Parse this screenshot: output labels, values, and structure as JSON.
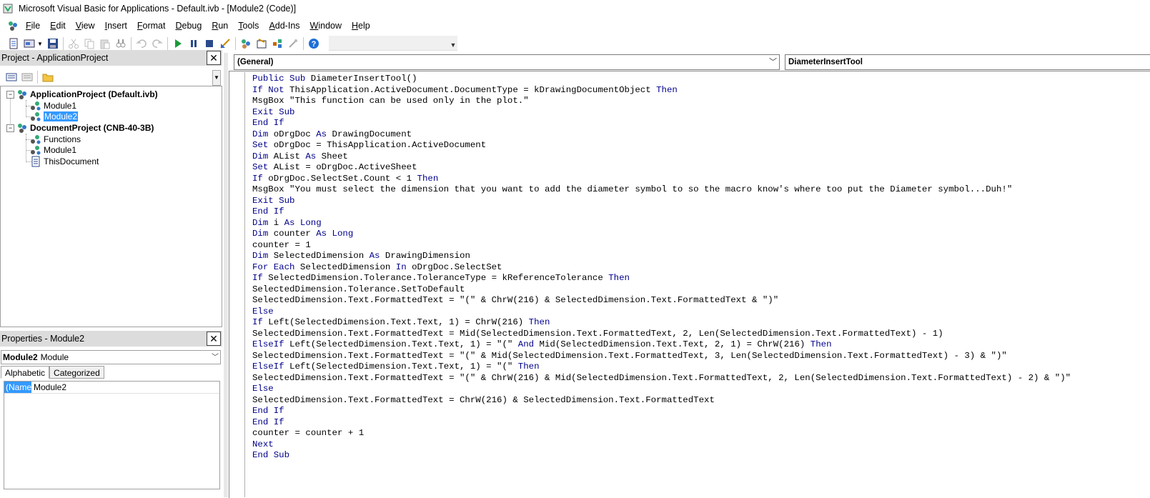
{
  "window": {
    "title": "Microsoft Visual Basic for Applications - Default.ivb - [Module2 (Code)]"
  },
  "menu": [
    {
      "label": "File",
      "u": "F",
      "rest": "ile"
    },
    {
      "label": "Edit",
      "u": "E",
      "rest": "dit"
    },
    {
      "label": "View",
      "u": "V",
      "rest": "iew"
    },
    {
      "label": "Insert",
      "u": "I",
      "rest": "nsert"
    },
    {
      "label": "Format",
      "u": "F",
      "rest": "ormat"
    },
    {
      "label": "Debug",
      "u": "D",
      "rest": "ebug"
    },
    {
      "label": "Run",
      "u": "R",
      "rest": "un"
    },
    {
      "label": "Tools",
      "u": "T",
      "rest": "ools"
    },
    {
      "label": "Add-Ins",
      "u": "A",
      "rest": "dd-Ins"
    },
    {
      "label": "Window",
      "u": "W",
      "rest": "indow"
    },
    {
      "label": "Help",
      "u": "H",
      "rest": "elp"
    }
  ],
  "project_pane": {
    "title": "Project - ApplicationProject",
    "tree": {
      "app_project": "ApplicationProject (Default.ivb)",
      "app_module1": "Module1",
      "app_module2": "Module2",
      "doc_project": "DocumentProject (CNB-40-3B)",
      "doc_functions": "Functions",
      "doc_module1": "Module1",
      "doc_thisdocument": "ThisDocument"
    }
  },
  "properties_pane": {
    "title": "Properties - Module2",
    "object_name": "Module2",
    "object_type": "Module",
    "tab_alphabetic": "Alphabetic",
    "tab_categorized": "Categorized",
    "prop_name": "(Name)",
    "prop_value": "Module2"
  },
  "code_window": {
    "object_combo": "(General)",
    "proc_combo": "DiameterInsertTool",
    "lines": [
      "<span class=\"kw\">Public Sub</span> DiameterInsertTool()",
      "<span class=\"kw\">If Not</span> ThisApplication.ActiveDocument.DocumentType = kDrawingDocumentObject <span class=\"kw\">Then</span>",
      "MsgBox \"This function can be used only in the plot.\"",
      "<span class=\"kw\">Exit Sub</span>",
      "<span class=\"kw\">End If</span>",
      "<span class=\"kw\">Dim</span> oDrgDoc <span class=\"kw\">As</span> DrawingDocument",
      "<span class=\"kw\">Set</span> oDrgDoc = ThisApplication.ActiveDocument",
      "<span class=\"kw\">Dim</span> AList <span class=\"kw\">As</span> Sheet",
      "<span class=\"kw\">Set</span> AList = oDrgDoc.ActiveSheet",
      "<span class=\"kw\">If</span> oDrgDoc.SelectSet.Count &lt; 1 <span class=\"kw\">Then</span>",
      "MsgBox \"You must select the dimension that you want to add the diameter symbol to so the macro know's where too put the Diameter symbol...Duh!\"",
      "<span class=\"kw\">Exit Sub</span>",
      "<span class=\"kw\">End If</span>",
      "<span class=\"kw\">Dim</span> i <span class=\"kw\">As Long</span>",
      "<span class=\"kw\">Dim</span> counter <span class=\"kw\">As Long</span>",
      "counter = 1",
      "<span class=\"kw\">Dim</span> SelectedDimension <span class=\"kw\">As</span> DrawingDimension",
      "<span class=\"kw\">For Each</span> SelectedDimension <span class=\"kw\">In</span> oDrgDoc.SelectSet",
      "<span class=\"kw\">If</span> SelectedDimension.Tolerance.ToleranceType = kReferenceTolerance <span class=\"kw\">Then</span>",
      "SelectedDimension.Tolerance.SetToDefault",
      "SelectedDimension.Text.FormattedText = \"(\" &amp; ChrW(216) &amp; SelectedDimension.Text.FormattedText &amp; \")\"",
      "<span class=\"kw\">Else</span>",
      "<span class=\"kw\">If</span> Left(SelectedDimension.Text.Text, 1) = ChrW(216) <span class=\"kw\">Then</span>",
      "SelectedDimension.Text.FormattedText = Mid(SelectedDimension.Text.FormattedText, 2, Len(SelectedDimension.Text.FormattedText) - 1)",
      "<span class=\"kw\">ElseIf</span> Left(SelectedDimension.Text.Text, 1) = \"(\" <span class=\"kw\">And</span> Mid(SelectedDimension.Text.Text, 2, 1) = ChrW(216) <span class=\"kw\">Then</span>",
      "SelectedDimension.Text.FormattedText = \"(\" &amp; Mid(SelectedDimension.Text.FormattedText, 3, Len(SelectedDimension.Text.FormattedText) - 3) &amp; \")\"",
      "<span class=\"kw\">ElseIf</span> Left(SelectedDimension.Text.Text, 1) = \"(\" <span class=\"kw\">Then</span>",
      "SelectedDimension.Text.FormattedText = \"(\" &amp; ChrW(216) &amp; Mid(SelectedDimension.Text.FormattedText, 2, Len(SelectedDimension.Text.FormattedText) - 2) &amp; \")\"",
      "<span class=\"kw\">Else</span>",
      "SelectedDimension.Text.FormattedText = ChrW(216) &amp; SelectedDimension.Text.FormattedText",
      "<span class=\"kw\">End If</span>",
      "<span class=\"kw\">End If</span>",
      "counter = counter + 1",
      "<span class=\"kw\">Next</span>",
      "<span class=\"kw\">End Sub</span>"
    ]
  },
  "colors": {
    "keyword": "#00008b",
    "selection": "#3399ff",
    "pane_header": "#dcdcdc"
  },
  "icons": [
    "vba-app-icon",
    "view-code-icon",
    "insert-userform-icon",
    "save-icon",
    "cut-icon",
    "copy-icon",
    "paste-icon",
    "find-icon",
    "undo-icon",
    "redo-icon",
    "run-icon",
    "break-icon",
    "reset-icon",
    "design-mode-icon",
    "project-explorer-icon",
    "properties-window-icon",
    "object-browser-icon",
    "toolbox-icon",
    "help-icon",
    "view-code-small-icon",
    "view-object-icon",
    "toggle-folders-icon",
    "close-icon",
    "module-icon",
    "project-icon",
    "document-icon"
  ]
}
